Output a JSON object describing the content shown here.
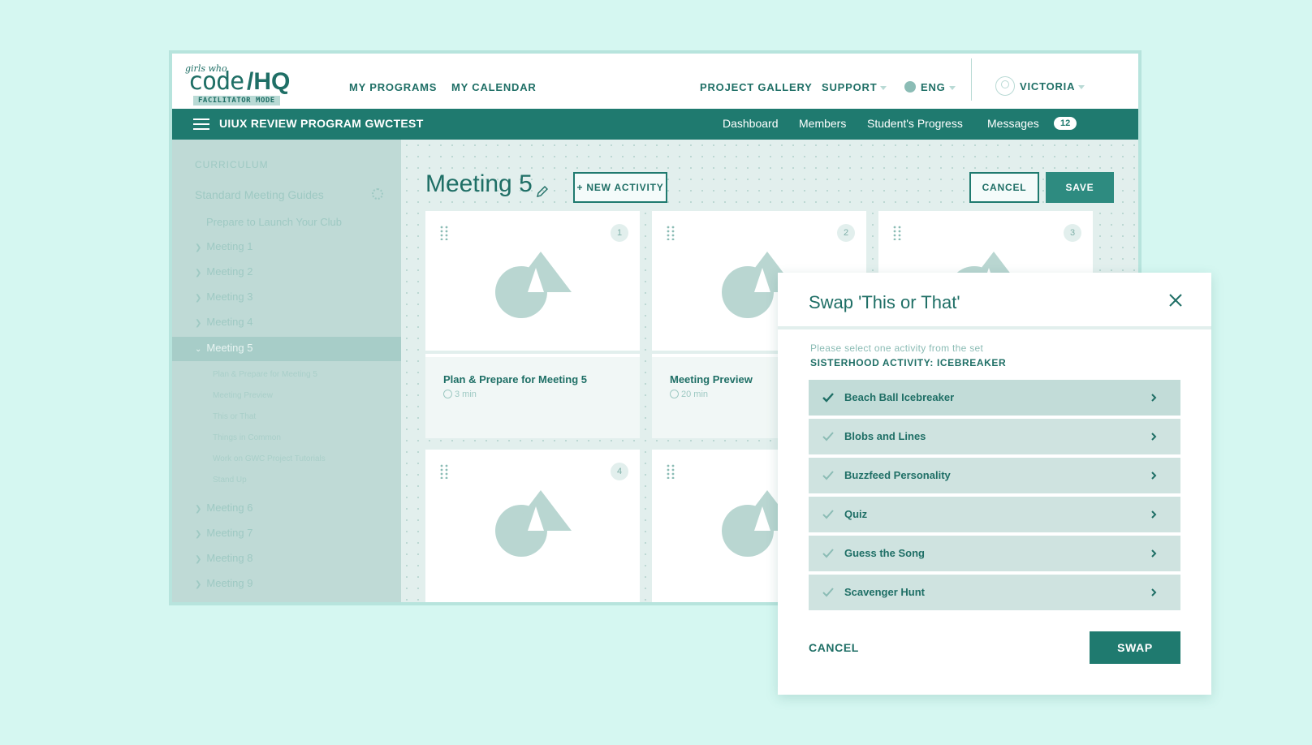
{
  "logo": {
    "script": "girls who",
    "code": "code",
    "hq": "/HQ",
    "mode": "FACILITATOR MODE"
  },
  "topnav": {
    "my_programs": "MY PROGRAMS",
    "my_calendar": "MY CALENDAR",
    "project_gallery": "PROJECT GALLERY",
    "support": "SUPPORT",
    "language": "ENG",
    "user": "VICTORIA"
  },
  "programbar": {
    "title": "UIUX REVIEW PROGRAM GWCTEST",
    "nav": [
      "Dashboard",
      "Members",
      "Student's Progress",
      "Messages"
    ],
    "messages_count": "12"
  },
  "sidebar": {
    "section": "CURRICULUM",
    "guide": "Standard Meeting Guides",
    "prepare": "Prepare to Launch Your Club",
    "meetings": [
      "Meeting 1",
      "Meeting 2",
      "Meeting 3",
      "Meeting 4",
      "Meeting 5",
      "Meeting 6",
      "Meeting 7",
      "Meeting 8",
      "Meeting 9"
    ],
    "sub_items": [
      "Plan & Prepare for Meeting 5",
      "Meeting Preview",
      "This or That",
      "Things in Common",
      "Work on GWC Project Tutorials",
      "Stand Up"
    ]
  },
  "main": {
    "title": "Meeting 5",
    "new_activity": "+ NEW ACTIVITY",
    "cancel": "CANCEL",
    "save": "SAVE",
    "cards": [
      {
        "num": "1",
        "title": "Plan & Prepare for Meeting 5",
        "duration": "3 min"
      },
      {
        "num": "2",
        "title": "Meeting Preview",
        "duration": "20 min"
      },
      {
        "num": "3",
        "title": "",
        "duration": ""
      },
      {
        "num": "4",
        "title": "",
        "duration": ""
      },
      {
        "num": "",
        "title": "",
        "duration": ""
      }
    ]
  },
  "modal": {
    "title": "Swap 'This or That'",
    "hint": "Please select one activity from the set",
    "set_name": "SISTERHOOD ACTIVITY: ICEBREAKER",
    "options": [
      "Beach Ball Icebreaker",
      "Blobs and Lines",
      "Buzzfeed Personality",
      "Quiz",
      "Guess the Song",
      "Scavenger Hunt"
    ],
    "selected_index": 0,
    "cancel": "CANCEL",
    "swap": "SWAP"
  },
  "colors": {
    "primary": "#1f7a6f",
    "background": "#d5f7f1",
    "sidebar": "#bfdad6"
  }
}
